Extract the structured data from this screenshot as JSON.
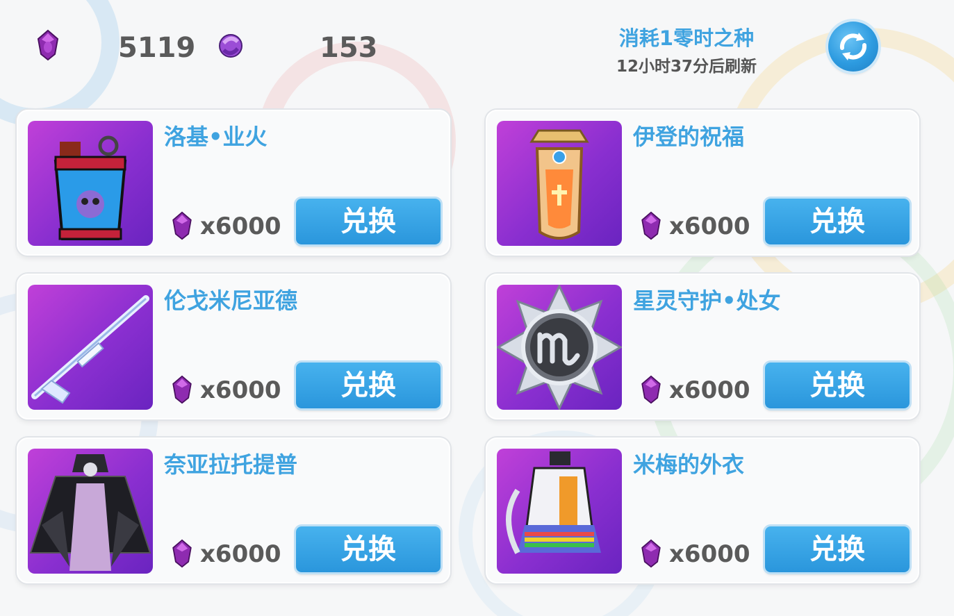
{
  "currency": {
    "seed_icon": "purple-seed-gem-icon",
    "seed_count": "5119",
    "token_icon": "purple-swirl-token-icon",
    "token_count": "153"
  },
  "refresh": {
    "cost_text": "消耗1零时之种",
    "countdown_text": "12小时37分后刷新",
    "button_icon": "refresh-arrows-icon"
  },
  "items": [
    {
      "name": "洛基•业火",
      "price": "x6000",
      "button": "兑换",
      "image": "grenade-canister-icon"
    },
    {
      "name": "伊登的祝福",
      "price": "x6000",
      "button": "兑换",
      "image": "golden-shield-relic-icon"
    },
    {
      "name": "伦戈米尼亚德",
      "price": "x6000",
      "button": "兑换",
      "image": "sniper-rifle-icon"
    },
    {
      "name": "星灵守护•处女",
      "price": "x6000",
      "button": "兑换",
      "image": "virgo-badge-icon"
    },
    {
      "name": "奈亚拉托提普",
      "price": "x6000",
      "button": "兑换",
      "image": "dark-cloak-icon"
    },
    {
      "name": "米梅的外衣",
      "price": "x6000",
      "button": "兑换",
      "image": "rainbow-coat-icon"
    }
  ],
  "colors": {
    "accent_blue": "#3fa3e0",
    "button_blue": "#2a96dc",
    "thumb_purple": "#8a2fd0",
    "text_gray": "#5a5a5a"
  }
}
